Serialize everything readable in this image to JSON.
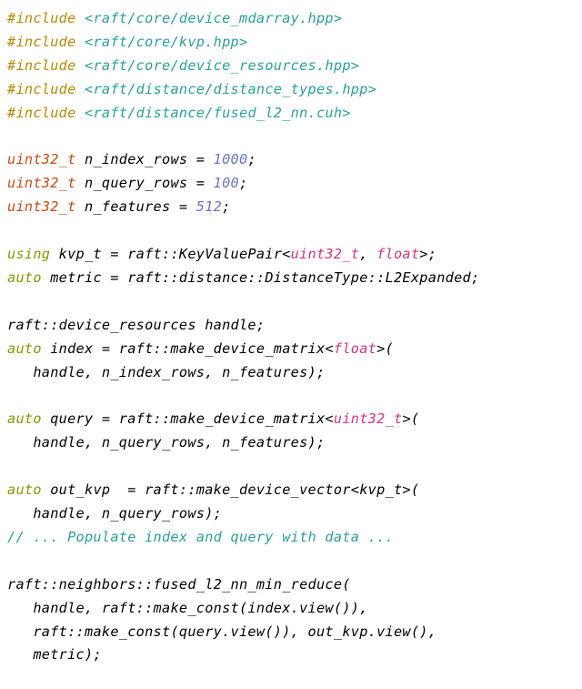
{
  "includes": {
    "d0": "#include",
    "p0": "<raft/core/device_mdarray.hpp>",
    "d1": "#include",
    "p1": "<raft/core/kvp.hpp>",
    "d2": "#include",
    "p2": "<raft/core/device_resources.hpp>",
    "d3": "#include",
    "p3": "<raft/distance/distance_types.hpp>",
    "d4": "#include",
    "p4": "<raft/distance/fused_l2_nn.cuh>"
  },
  "decl": {
    "u32_0": "uint32_t",
    "nindex": " n_index_rows = ",
    "v1000": "1000",
    "u32_1": "uint32_t",
    "nquery": " n_query_rows = ",
    "v100": "100",
    "u32_2": "uint32_t",
    "nfeat": " n_features = ",
    "v512": "512",
    "semi": ";"
  },
  "kvp": {
    "using": "using",
    "name": " kvp_t = raft::KeyValuePair<",
    "t1": "uint32_t",
    "comma": ", ",
    "t2": "float",
    "end": ">;"
  },
  "metric": {
    "auto": "auto",
    "rest": " metric = raft::distance::DistanceType::L2Expanded;"
  },
  "handle": {
    "line": "raft::device_resources handle;"
  },
  "index": {
    "auto": "auto",
    "a": " index = raft::make_device_matrix<",
    "t": "float",
    "b": ">(",
    "args": "   handle, n_index_rows, n_features);"
  },
  "query": {
    "auto": "auto",
    "a": " query = raft::make_device_matrix<",
    "t": "uint32_t",
    "b": ">(",
    "args": "   handle, n_query_rows, n_features);"
  },
  "outkvp": {
    "auto": "auto",
    "a": " out_kvp  = raft::make_device_vector<kvp_t>(",
    "args": "   handle, n_query_rows);"
  },
  "comment": {
    "text": "// ... Populate index and query with data ..."
  },
  "call": {
    "l0": "raft::neighbors::fused_l2_nn_min_reduce(",
    "l1": "   handle, raft::make_const(index.view()),",
    "l2": "   raft::make_const(query.view()), out_kvp.view(),",
    "l3": "   metric);"
  }
}
